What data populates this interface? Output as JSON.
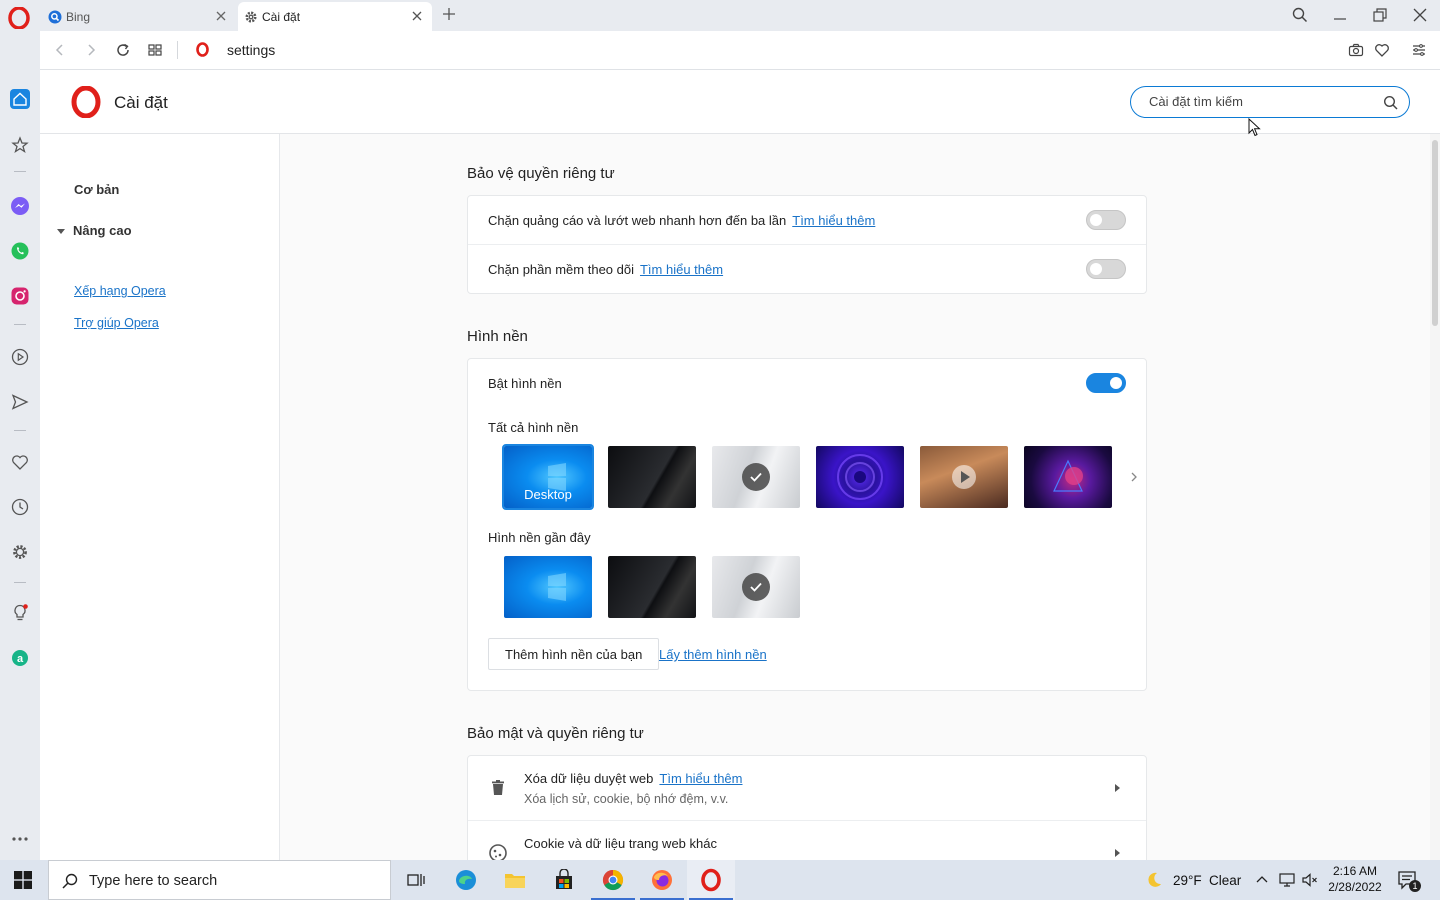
{
  "browser": {
    "tabs": [
      {
        "label": "Bing",
        "icon": "bing-search-icon"
      },
      {
        "label": "Cài đặt",
        "icon": "gear-icon"
      }
    ],
    "url": "settings"
  },
  "header": {
    "title": "Cài đặt",
    "search_placeholder": "Cài đặt tìm kiếm"
  },
  "nav": {
    "basic": "Cơ bản",
    "advanced": "Nâng cao",
    "links": [
      "Xếp hạng Opera",
      "Trợ giúp Opera"
    ]
  },
  "privacy": {
    "title": "Bảo vệ quyền riêng tư",
    "rows": [
      {
        "text": "Chặn quảng cáo và lướt web nhanh hơn đến ba lần",
        "link": "Tìm hiểu thêm",
        "enabled": false
      },
      {
        "text": "Chặn phần mềm theo dõi",
        "link": "Tìm hiểu thêm",
        "enabled": false
      }
    ]
  },
  "wallpaper": {
    "title": "Hình nền",
    "enable_label": "Bật hình nền",
    "enabled": true,
    "all_label": "Tất cả hình nền",
    "desktop_label": "Desktop",
    "recent_label": "Hình nền gần đây",
    "add_button": "Thêm hình nền của bạn",
    "more_link": "Lấy thêm hình nền"
  },
  "security": {
    "title": "Bảo mật và quyền riêng tư",
    "rows": [
      {
        "title": "Xóa dữ liệu duyệt web",
        "link": "Tìm hiểu thêm",
        "subtitle": "Xóa lịch sử, cookie, bộ nhớ đệm, v.v."
      },
      {
        "title": "Cookie và dữ liệu trang web khác",
        "subtitle": ""
      }
    ]
  },
  "taskbar": {
    "search_text": "Type here to search",
    "weather_temp": "29°F",
    "weather_text": "Clear",
    "time": "2:16 AM",
    "date": "2/28/2022",
    "notification_count": "1"
  },
  "colors": {
    "accent": "#1a85e0",
    "link": "#1a73c8",
    "opera_red": "#e0201a"
  }
}
